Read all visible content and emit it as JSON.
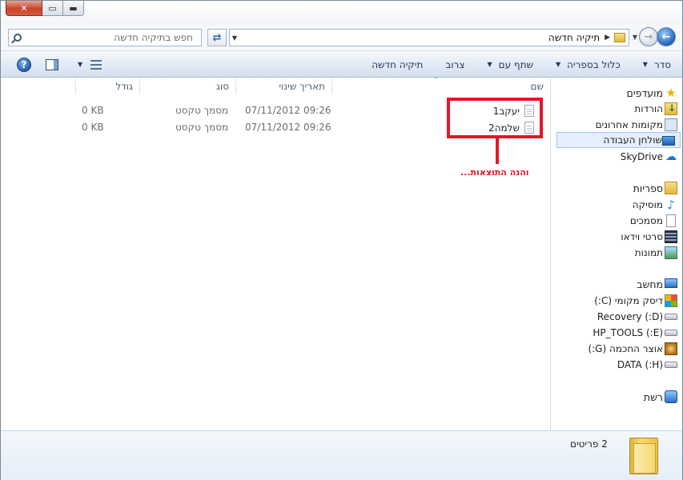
{
  "window": {
    "controls": {
      "close_icon": "✕",
      "maximize_icon": "▭",
      "minimize_icon": "▬"
    }
  },
  "address_bar": {
    "breadcrumb": [
      "תיקיה חדשה"
    ],
    "separator": "▶",
    "search_placeholder": "חפש בתיקיה חדשה",
    "search_value": ""
  },
  "command_bar": {
    "items": [
      {
        "label": "סדר",
        "has_dropdown": true
      },
      {
        "label": "כלול בספריה",
        "has_dropdown": true
      },
      {
        "label": "שתף עם",
        "has_dropdown": true
      },
      {
        "label": "צרוב",
        "has_dropdown": false
      },
      {
        "label": "תיקיה חדשה",
        "has_dropdown": false
      }
    ],
    "help_icon_glyph": "?"
  },
  "columns": {
    "name": "שם",
    "date_modified": "תאריך שינוי",
    "type": "סוג",
    "size": "גודל"
  },
  "files": [
    {
      "name": "יעקב1",
      "date_modified": "07/11/2012 09:26",
      "type": "מסמך טקסט",
      "size": "0 KB"
    },
    {
      "name": "שלמה2",
      "date_modified": "07/11/2012 09:26",
      "type": "מסמך טקסט",
      "size": "0 KB"
    }
  ],
  "annotation": {
    "text": "והנה התוצאות...",
    "color": "#e0182a"
  },
  "nav_pane": {
    "favorites": {
      "label": "מועדפים",
      "items": [
        "הורדות",
        "מקומות אחרונים",
        "שולחן העבודה",
        "SkyDrive"
      ]
    },
    "libraries": {
      "label": "ספריות",
      "items": [
        "מוסיקה",
        "מסמכים",
        "סרטי וידאו",
        "תמונות"
      ]
    },
    "computer": {
      "label": "מחשב",
      "items": [
        "דיסק מקומי (C:)",
        "(D:) Recovery",
        "(E:) HP_TOOLS",
        "אוצר החכמה (G:)",
        "(H:) DATA"
      ]
    },
    "network": {
      "label": "רשת"
    },
    "selected": "שולחן העבודה"
  },
  "details_pane": {
    "summary": "2 פריטים"
  },
  "colors": {
    "accent": "#1e395b",
    "selection": "#e5eefb",
    "annotation": "#e0182a"
  }
}
